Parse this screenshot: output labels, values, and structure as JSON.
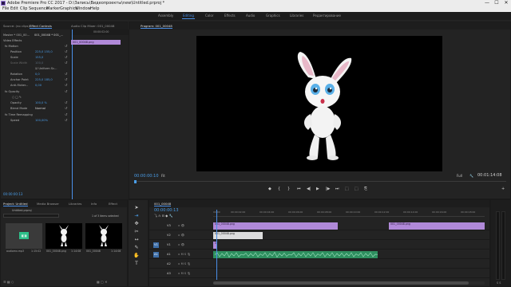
{
  "titlebar": {
    "title": "Adobe Premiere Pro CC 2017 - D:\\Запись\\Видеопроекты\\new\\Untitled.prproj *",
    "minimize": "—",
    "maximize": "☐",
    "close": "✕"
  },
  "menu": [
    "File",
    "Edit",
    "Clip",
    "Sequence",
    "Marker",
    "Graphics",
    "Window",
    "Help"
  ],
  "workspaces": [
    "Assembly",
    "Editing",
    "Color",
    "Effects",
    "Audio",
    "Graphics",
    "Libraries",
    "Редактирование"
  ],
  "workspace_active": "Editing",
  "source_panel": {
    "tabs": [
      "Source: (no clips)",
      "Effect Controls",
      "Audio Clip Mixer: 001_00048",
      "Metadata"
    ],
    "master_label": "Master * 001_00...",
    "clip_label": "001_00048 * 001_...",
    "video_effects_label": "Video Effects",
    "ec_timecode": "00:00:02:00",
    "clip_bar_label": "001_00048.png",
    "effects": [
      {
        "name": "fx Motion",
        "value": ""
      },
      {
        "name": "Position",
        "value": "225,0    155,0"
      },
      {
        "name": "Scale",
        "value": "155,0"
      },
      {
        "name": "Scale Width",
        "value": "100,0"
      },
      {
        "name": "",
        "value": "☑ Uniform Sc..."
      },
      {
        "name": "Rotation",
        "value": "0,0"
      },
      {
        "name": "Anchor Point",
        "value": "225,0    185,0"
      },
      {
        "name": "Anti-flicker...",
        "value": "0,00"
      },
      {
        "name": "fx Opacity",
        "value": ""
      },
      {
        "name": "",
        "value": "○ □ ✎"
      },
      {
        "name": "Opacity",
        "value": "100,0 %"
      },
      {
        "name": "Blend Mode",
        "value": "Normal"
      },
      {
        "name": "fx Time Remapping",
        "value": ""
      },
      {
        "name": "Speed",
        "value": "100,00%"
      }
    ],
    "bottom_timecode": "00:00:00:13"
  },
  "program": {
    "tab_label": "Program: 001_00048",
    "timecode": "00:00:00:10",
    "fit": "Fit",
    "quality": "Full",
    "duration": "00:01:14:08",
    "controls": [
      "◆",
      "{",
      "}",
      "⏮",
      "◀|",
      "▶",
      "|▶",
      "⏭",
      "⬚",
      "⬚",
      "⎘",
      "+"
    ]
  },
  "project": {
    "tabs": [
      "Project: Untitled",
      "Media Browser",
      "Libraries",
      "Info",
      "Effect"
    ],
    "project_file": "Untitled.prproj",
    "items_selected": "1 of 3 items selected",
    "thumbs": [
      {
        "label": "audiomx.mp3",
        "duration": "1:15:02"
      },
      {
        "label": "001_00048.png",
        "duration": "1:14:08"
      },
      {
        "label": "001_00048",
        "duration": "1:14:08"
      }
    ]
  },
  "timeline": {
    "tab_label": "001_00048",
    "timecode": "00:00:00:13",
    "ruler": [
      "00:00",
      "00:00:02:00",
      "00:00:04:00",
      "00:00:06:00",
      "00:00:08:00",
      "00:00:10:00",
      "00:00:12:00",
      "00:00:14:00",
      "00:00:16:00",
      "00:00:18:00"
    ],
    "tracks": [
      {
        "name": "V3",
        "type": "video"
      },
      {
        "name": "V2",
        "type": "video"
      },
      {
        "name": "V1",
        "type": "video"
      },
      {
        "name": "A1",
        "type": "audio"
      },
      {
        "name": "A2",
        "type": "audio"
      },
      {
        "name": "A3",
        "type": "audio"
      }
    ],
    "clip_v3_a": "001_00048.png",
    "clip_v3_b": "001_00048.png",
    "clip_v2": "001_00048.png",
    "clip_v1": "001_00048.png"
  },
  "colors": {
    "accent": "#4a9de8",
    "clip_purple": "#b089d8",
    "clip_green": "#2e8f5f",
    "clip_white": "#dcdcdc"
  }
}
